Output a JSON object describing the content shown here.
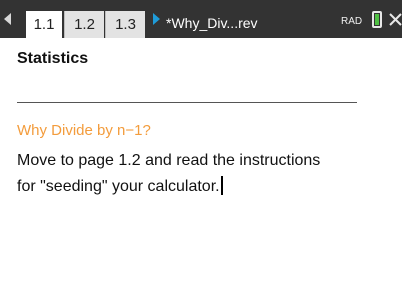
{
  "topbar": {
    "tabs": [
      {
        "label": "1.1",
        "active": true
      },
      {
        "label": "1.2",
        "active": false
      },
      {
        "label": "1.3",
        "active": false
      }
    ],
    "document_title": "*Why_Div...rev",
    "mode": "RAD",
    "icons": [
      "left-arrow-icon",
      "doc-arrow-icon",
      "battery-icon",
      "close-icon"
    ],
    "colors": {
      "bar": "#333333",
      "doc_arrow": "#1f9bd8",
      "battery": "#4fc043"
    }
  },
  "content": {
    "heading": "Statistics",
    "subtitle": "Why Divide by n−1?",
    "body_line1": "Move to page 1.2 and read the instructions",
    "body_line2": "for \"seeding\" your calculator.",
    "subtitle_color": "#f39c3c"
  }
}
